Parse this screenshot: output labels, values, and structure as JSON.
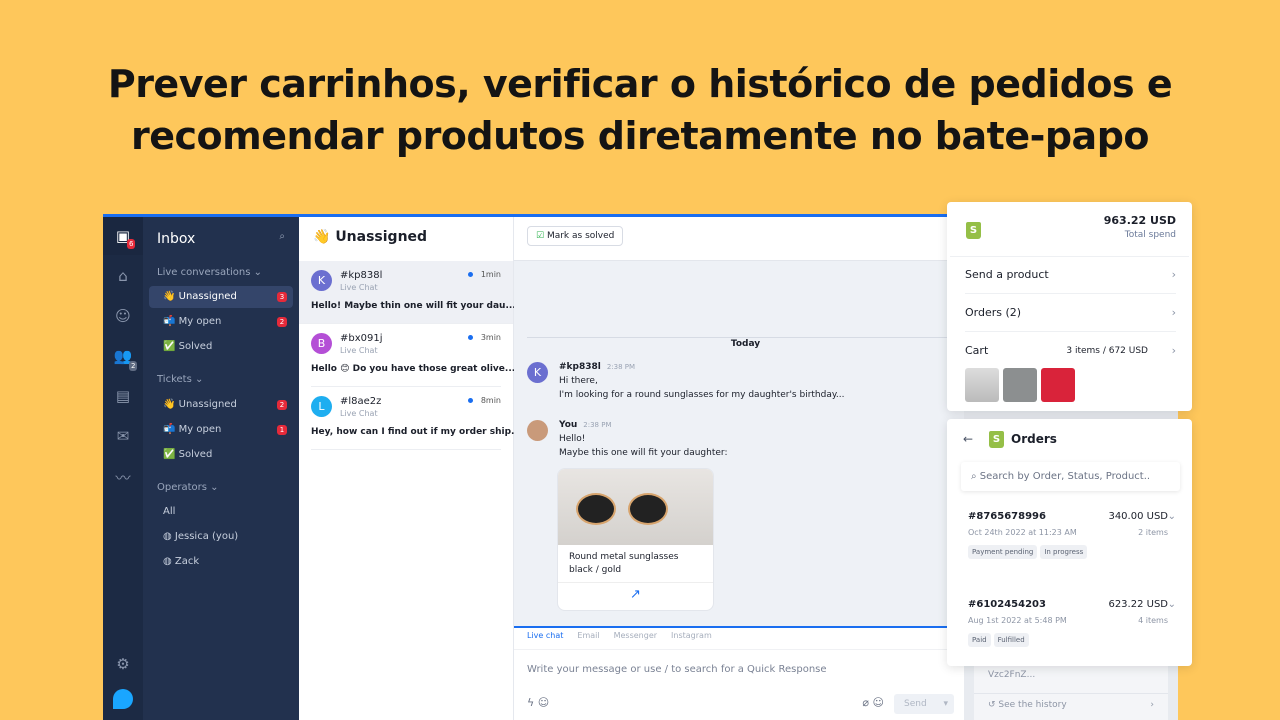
{
  "headline": {
    "line1": "Prever carrinhos, verificar o histórico de pedidos e",
    "line2": "recomendar produtos diretamente no bate-papo"
  },
  "rail": {
    "inbox_badge": "6",
    "team_badge": "2"
  },
  "sidebar": {
    "title": "Inbox",
    "live_section": "Live conversations ⌄",
    "live_items": [
      {
        "emoji": "👋",
        "label": "Unassigned",
        "count": "3"
      },
      {
        "emoji": "📬",
        "label": "My open",
        "count": "2"
      },
      {
        "emoji": "✅",
        "label": "Solved"
      }
    ],
    "tickets_section": "Tickets ⌄",
    "ticket_items": [
      {
        "emoji": "👋",
        "label": "Unassigned",
        "count": "2"
      },
      {
        "emoji": "📬",
        "label": "My open",
        "count": "1"
      },
      {
        "emoji": "✅",
        "label": "Solved"
      }
    ],
    "operators_section": "Operators ⌄",
    "operators": [
      {
        "label": "All"
      },
      {
        "label": "Jessica (you)"
      },
      {
        "label": "Zack"
      }
    ]
  },
  "list": {
    "title": "Unassigned",
    "emoji": "👋",
    "conversations": [
      {
        "initial": "K",
        "color": "#6b6fd0",
        "id": "#kp838l",
        "channel": "Live Chat",
        "time": "1min",
        "preview": "Hello! Maybe thin one will fit your dau..."
      },
      {
        "initial": "B",
        "color": "#b44fd6",
        "id": "#bx091j",
        "channel": "Live Chat",
        "time": "3min",
        "preview": "Hello 😊 Do you have those great olive..."
      },
      {
        "initial": "L",
        "color": "#1eaef0",
        "id": "#l8ae2z",
        "channel": "Live Chat",
        "time": "8min",
        "preview": "Hey, how can I find out if my order ship..."
      }
    ]
  },
  "chat": {
    "mark_solved": "Mark as solved",
    "today": "Today",
    "msg1": {
      "initial": "K",
      "author": "#kp838l",
      "time": "2:38 PM",
      "line1": "Hi there,",
      "line2": "I'm looking for a round sunglasses for my daughter's birthday..."
    },
    "msg2": {
      "author": "You",
      "time": "2:38 PM",
      "line1": "Hello!",
      "line2": "Maybe this one will fit your daughter:"
    },
    "product": {
      "name": "Round metal sunglasses",
      "variant": "black / gold"
    },
    "tabs": [
      "Live chat",
      "Email",
      "Messenger",
      "Instagram"
    ],
    "placeholder": "Write your message or use / to search for a Quick Response",
    "send": "Send"
  },
  "rightcol": {
    "snippet": "Vzc2FnZ...",
    "history": "See the history"
  },
  "shopify": {
    "total": "963.22 USD",
    "total_label": "Total spend",
    "send_product": "Send a product",
    "orders": "Orders (2)",
    "cart": "Cart",
    "cart_summary": "3 items / 672 USD"
  },
  "orders": {
    "title": "Orders",
    "search_placeholder": "Search by Order, Status, Product..",
    "items": [
      {
        "id": "#8765678996",
        "amount": "340.00 USD",
        "date": "Oct 24th 2022 at 11:23 AM",
        "count": "2 items",
        "tags": [
          "Payment pending",
          "In progress"
        ]
      },
      {
        "id": "#6102454203",
        "amount": "623.22 USD",
        "date": "Aug 1st 2022 at 5:48 PM",
        "count": "4 items",
        "tags": [
          "Paid",
          "Fulfilled"
        ]
      }
    ]
  }
}
